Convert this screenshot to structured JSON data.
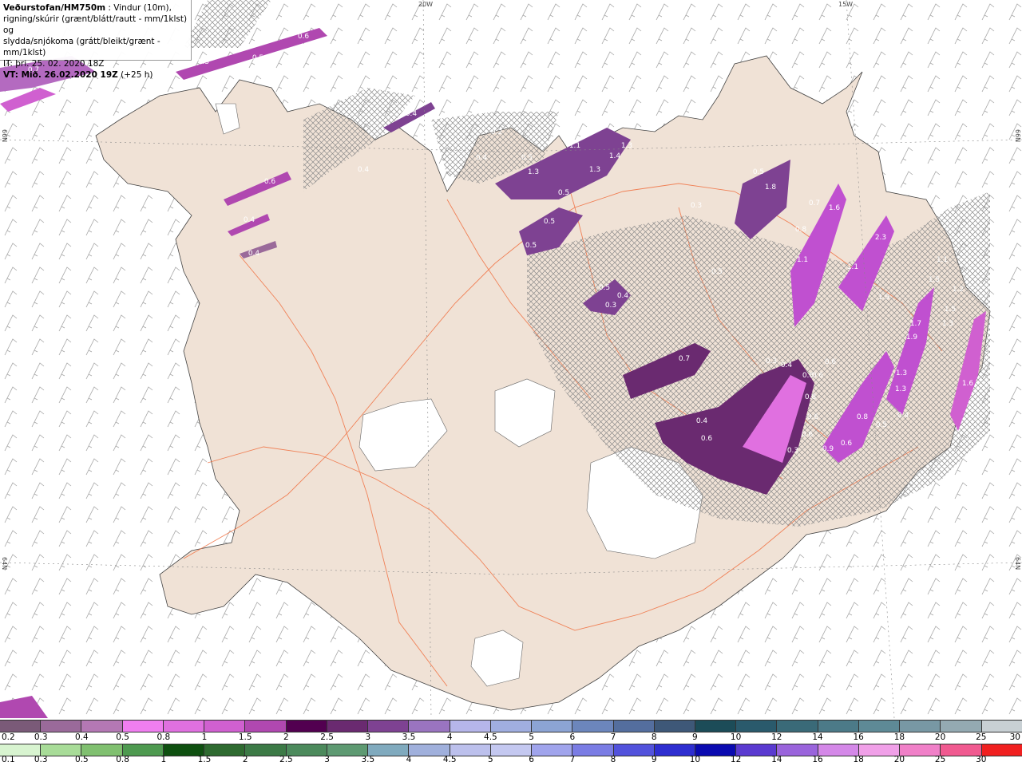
{
  "title": {
    "brand": "Veðurstofan/HM750m",
    "desc1": " : Vindur (10m),",
    "desc2": "rigning/skúrir (grænt/blátt/rautt - mm/1klst) og",
    "desc3": "slydda/snjókoma (grátt/bleikt/grænt - mm/1klst)",
    "it": "IT: þri. 25. 02. 2020 18Z",
    "vt_label": "VT: Mið. 26.02.2020 19Z",
    "vt_lead": " (+25 h)"
  },
  "axes": {
    "top_20w": "20W",
    "top_15w": "15W",
    "left_66n": "66N",
    "left_64n": "64N",
    "right_66n": "66N",
    "right_64n": "64N"
  },
  "legend_sleet": {
    "labels": [
      "0.2",
      "0.3",
      "0.4",
      "0.5",
      "0.8",
      "1",
      "1.5",
      "2",
      "2.5",
      "3",
      "3.5",
      "4",
      "4.5",
      "5",
      "6",
      "7",
      "8",
      "9",
      "10",
      "12",
      "14",
      "16",
      "18",
      "20",
      "25",
      "30"
    ],
    "colors": [
      "#7a5a78",
      "#9a6a9a",
      "#b478b4",
      "#f07ef0",
      "#e070e0",
      "#d060d0",
      "#b048b0",
      "#520050",
      "#6a2a70",
      "#7e4292",
      "#9a74c0",
      "#b6b6ea",
      "#a0aee0",
      "#8ca4d4",
      "#6c86bc",
      "#546e9e",
      "#3e5878",
      "#1c4c58",
      "#2a5a6c",
      "#3a6a78",
      "#4c7a88",
      "#5e8a96",
      "#7898a4",
      "#94aab2",
      "#c8d0d4"
    ]
  },
  "legend_rain": {
    "labels": [
      "0.1",
      "0.3",
      "0.5",
      "0.8",
      "1",
      "1.5",
      "2",
      "2.5",
      "3",
      "3.5",
      "4",
      "4.5",
      "5",
      "6",
      "7",
      "8",
      "9",
      "10",
      "12",
      "14",
      "16",
      "18",
      "20",
      "25",
      "30"
    ],
    "colors": [
      "#d8f4d0",
      "#a8dc98",
      "#80c070",
      "#4e9a50",
      "#0e5010",
      "#2e6a30",
      "#3c7a46",
      "#4c8a5c",
      "#5e9a72",
      "#80aabe",
      "#a0b0dc",
      "#bcc0ec",
      "#c4c8f0",
      "#a0a4ec",
      "#7a7ce4",
      "#5252dc",
      "#2e2ed0",
      "#0a0ab0",
      "#5a3ad0",
      "#9a64dc",
      "#d488e8",
      "#f0a0e8",
      "#f080c8",
      "#f05a90",
      "#f02020"
    ]
  },
  "precip_labels": [
    "0.7",
    "0.5",
    "0.5",
    "0.6",
    "0.4",
    "0.4",
    "0.6",
    "0.4",
    "0.4",
    "0.4",
    "0.2",
    "0.5",
    "1.1",
    "1.4",
    "1.3",
    "1.3",
    "0.3",
    "1.3",
    "0.5",
    "1.8",
    "0.5",
    "0.5",
    "0.5",
    "0.7",
    "1.6",
    "2.3",
    "1.1",
    "1.1",
    "0.8",
    "1.1",
    "1.5",
    "1.5",
    "1.2",
    "1.3",
    "0.5",
    "0.5",
    "0.3",
    "0.4",
    "0.7",
    "0.3",
    "0.4",
    "0.6",
    "0.6",
    "0.6",
    "0.8",
    "0.8",
    "0.6",
    "0.4",
    "0.6",
    "0.6",
    "0.9",
    "0.6",
    "0.3",
    "1.9",
    "1.7",
    "1.9",
    "1.3",
    "1.3",
    "1.6",
    "0.4",
    "0.5"
  ]
}
